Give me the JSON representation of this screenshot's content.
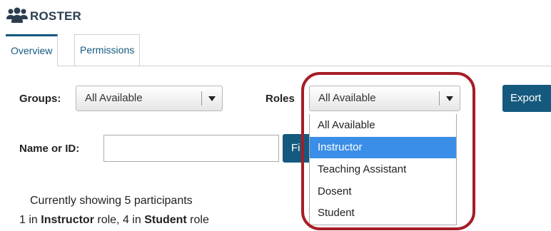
{
  "header": {
    "title": "ROSTER",
    "icon": "users-icon"
  },
  "tabs": [
    {
      "label": "Overview"
    },
    {
      "label": "Permissions"
    }
  ],
  "filters": {
    "groups_label": "Groups:",
    "groups_value": "All Available",
    "roles_label": "Roles",
    "roles_value": "All Available",
    "export_label": "Export",
    "name_label": "Name or ID:",
    "name_value": "",
    "find_label": "Fi"
  },
  "roles_dropdown": {
    "options": [
      "All Available",
      "Instructor",
      "Teaching Assistant",
      "Dosent",
      "Student"
    ],
    "highlighted": "Instructor"
  },
  "summary": {
    "line1": "Currently showing 5 participants",
    "line2_prefix": "1 in ",
    "line2_role1": "Instructor",
    "line2_mid": " role, 4 in ",
    "line2_role2": "Student",
    "line2_suffix": " role"
  },
  "colors": {
    "accent": "#15597e",
    "highlight_ring": "#a51d26",
    "selected_option": "#3b8ee8"
  }
}
